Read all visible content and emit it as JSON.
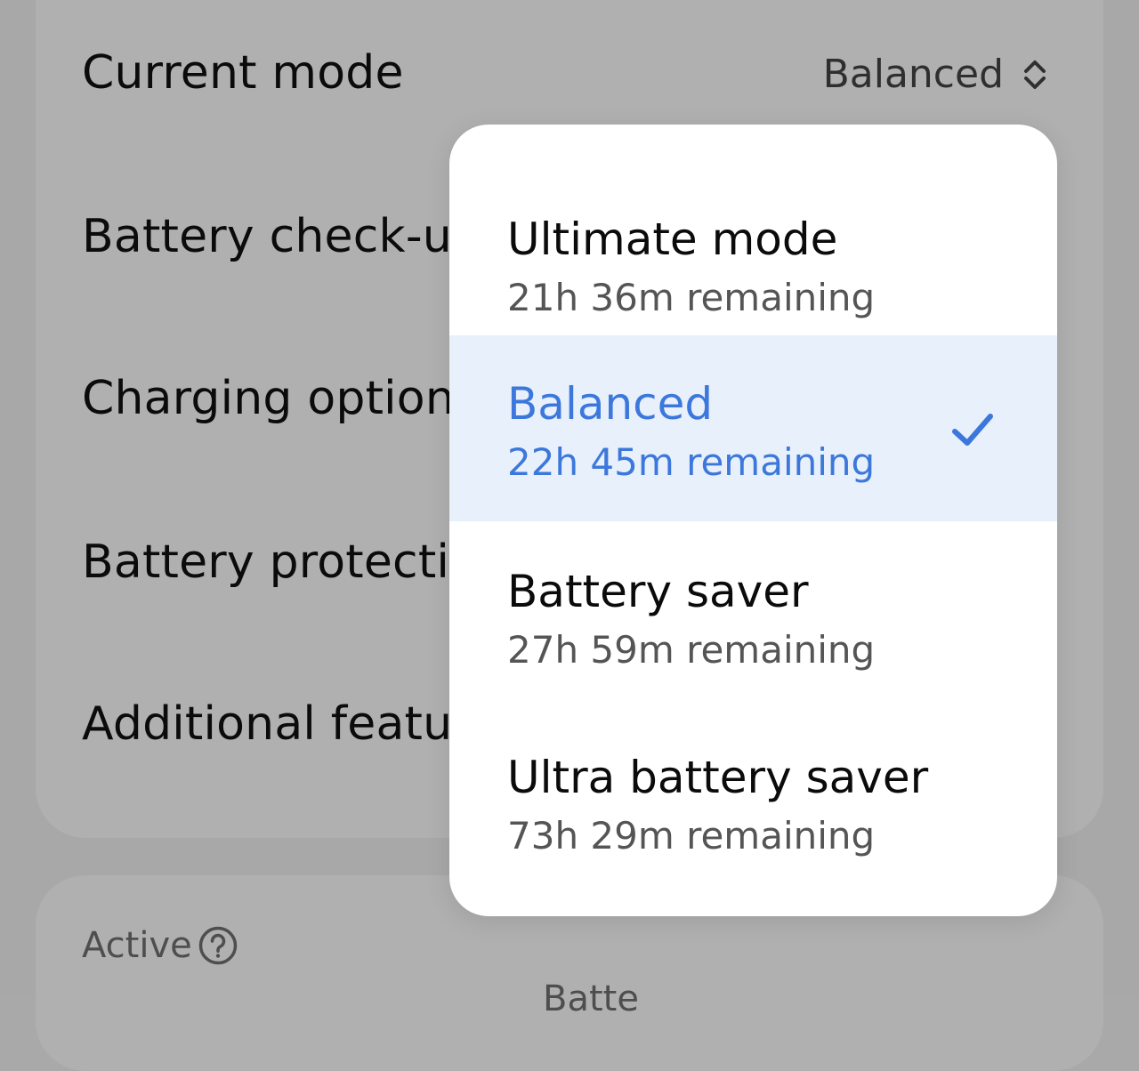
{
  "settings": {
    "current_mode_label": "Current mode",
    "current_mode_value": "Balanced",
    "rows": [
      {
        "label": "Battery check-u"
      },
      {
        "label": "Charging option"
      },
      {
        "label": "Battery protecti"
      },
      {
        "label": "Additional featu"
      }
    ]
  },
  "active_section": {
    "label": "Active",
    "peek_text": "Batte"
  },
  "dropdown": {
    "options": [
      {
        "title": "Ultimate mode",
        "remaining": "21h 36m remaining",
        "selected": false
      },
      {
        "title": "Balanced",
        "remaining": "22h 45m remaining",
        "selected": true
      },
      {
        "title": "Battery saver",
        "remaining": "27h 59m remaining",
        "selected": false
      },
      {
        "title": "Ultra battery saver",
        "remaining": "73h 29m remaining",
        "selected": false
      }
    ]
  },
  "colors": {
    "accent": "#3c78dc",
    "selected_bg": "#e8f0fc",
    "dim_overlay_bg": "#a8a8a8"
  },
  "icons": {
    "mode_selector": "updown-chevron-icon",
    "selected_check": "check-icon",
    "help": "question-circle-icon"
  }
}
